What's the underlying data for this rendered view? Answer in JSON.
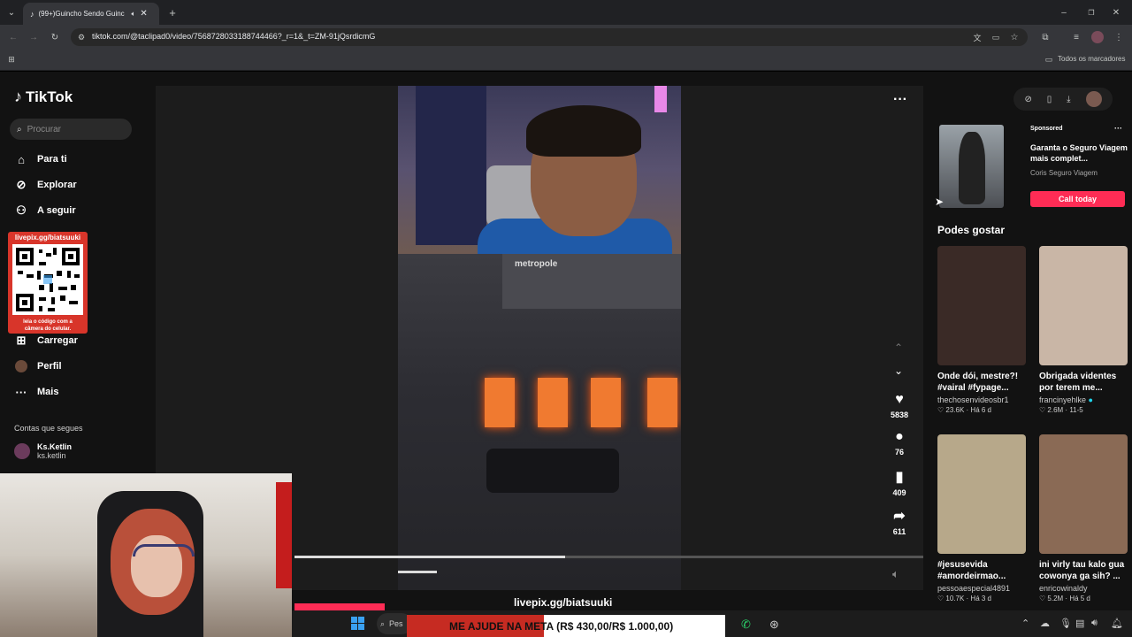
{
  "browser": {
    "tab_title": "(99+)Guincho Sendo Guinc",
    "url": "tiktok.com/@taclipad0/video/7568728033188744466?_r=1&_t=ZM-91jQsrdicmG",
    "bookmarks_label": "Todos os marcadores"
  },
  "tiktok": {
    "logo": "TikTok",
    "search_placeholder": "Procurar",
    "nav": [
      {
        "label": "Para ti",
        "icon": "home-icon"
      },
      {
        "label": "Explorar",
        "icon": "compass-icon"
      },
      {
        "label": "A seguir",
        "icon": "person-follow-icon"
      },
      {
        "label": "Carregar",
        "icon": "plus-square-icon"
      },
      {
        "label": "Perfil",
        "icon": "avatar-icon"
      },
      {
        "label": "Mais",
        "icon": "more-dots-icon"
      }
    ],
    "following_title": "Contas que segues",
    "following": [
      {
        "name": "Ks.Ketlin",
        "handle": "ks.ketlin"
      }
    ]
  },
  "qr_overlay": {
    "url": "livepix.gg/biatsuuki",
    "caption_line1": "leia o código com a",
    "caption_line2": "câmera do celular."
  },
  "video": {
    "sign_text": "metropole",
    "progress": 0.43,
    "actions": [
      {
        "icon": "heart-icon",
        "count": "5838"
      },
      {
        "icon": "comment-icon",
        "count": "76"
      },
      {
        "icon": "bookmark-icon",
        "count": "409"
      },
      {
        "icon": "share-icon",
        "count": "611"
      }
    ]
  },
  "ad": {
    "sponsored": "Sponsored",
    "title": "Garanta o Seguro Viagem mais complet...",
    "advertiser": "Coris Seguro Viagem",
    "cta": "Call today"
  },
  "recommended": {
    "title": "Podes gostar",
    "cards": [
      {
        "title1": "Onde dói, mestre?!",
        "title2": "#vairal #fypage...",
        "user": "thechosenvideosbr1",
        "likes": "23.6K",
        "date": "Há 6 d",
        "color": "#3a2a26"
      },
      {
        "title1": "Obrigada videntes",
        "title2": "por terem me...",
        "user": "francinyehlke",
        "likes": "2.6M",
        "date": "11-5",
        "color": "#c9b6a6"
      },
      {
        "title1": "#jesusevida",
        "title2": "#amordeirmao...",
        "user": "pessoaespecial4891",
        "likes": "10.7K",
        "date": "Há 3 d",
        "color": "#b7a88a"
      },
      {
        "title1": "ini virly tau kalo gua",
        "title2": "cowonya ga sih? ...",
        "user": "enricowinaldy",
        "likes": "5.2M",
        "date": "Há 5 d",
        "color": "#8a6a55"
      }
    ]
  },
  "stream": {
    "livepix": "livepix.gg/biatsuuki",
    "meta_text": "ME AJUDE NA META (R$ 430,00/R$ 1.000,00)",
    "meta_progress": 0.43,
    "taskbar_search": "Pes"
  }
}
